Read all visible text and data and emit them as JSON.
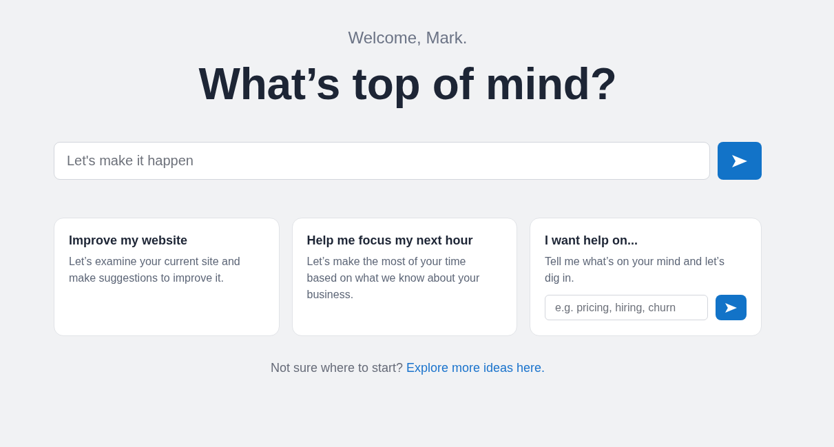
{
  "greeting": "Welcome, Mark.",
  "heading": "What’s top of mind?",
  "prompt": {
    "placeholder": "Let's make it happen"
  },
  "cards": [
    {
      "kind": "suggestion",
      "title": "Improve my website",
      "description": "Let’s examine your current site and make suggestions to improve it."
    },
    {
      "kind": "suggestion",
      "title": "Help me focus my next hour",
      "description": "Let’s make the most of your time based on what we know about your business."
    },
    {
      "kind": "input",
      "title": "I want help on...",
      "description": "Tell me what’s on your mind and let’s dig in.",
      "placeholder": "e.g. pricing, hiring, churn"
    }
  ],
  "footer": {
    "text": "Not sure where to start?",
    "link": "Explore more ideas here."
  }
}
